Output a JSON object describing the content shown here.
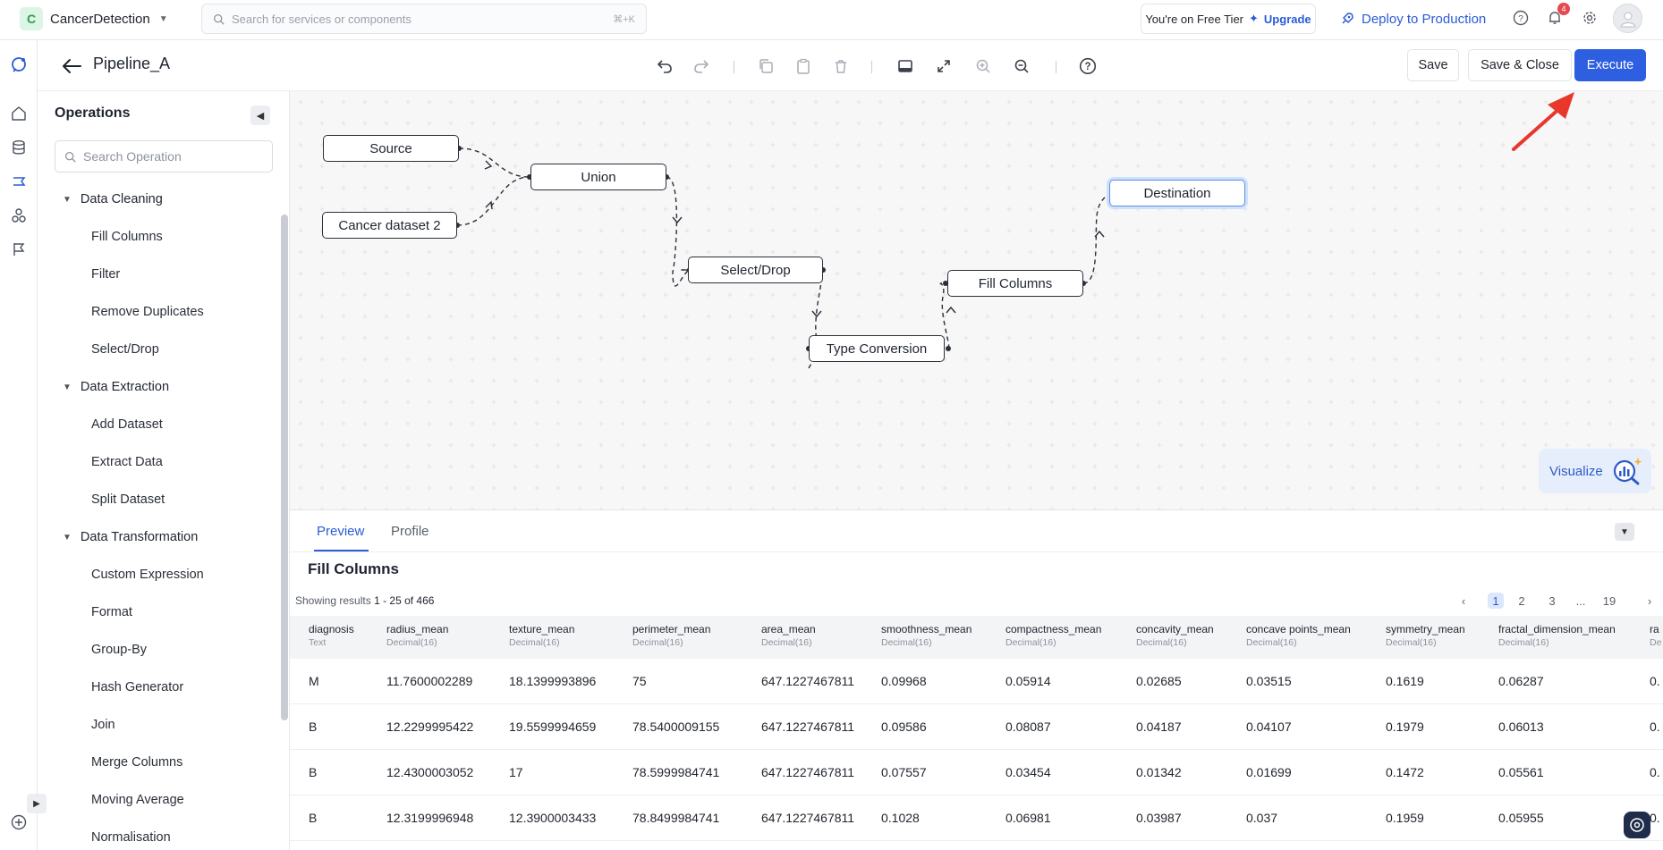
{
  "topbar": {
    "project_initial": "C",
    "project_name": "CancerDetection",
    "search_placeholder": "Search for services or components",
    "search_shortcut": "⌘+K",
    "tier_text": "You're on Free Tier",
    "upgrade_label": "Upgrade",
    "deploy_label": "Deploy to Production",
    "notification_count": "4"
  },
  "toolbar": {
    "pipeline_name": "Pipeline_A",
    "save_label": "Save",
    "save_close_label": "Save & Close",
    "execute_label": "Execute"
  },
  "operations": {
    "title": "Operations",
    "search_placeholder": "Search Operation",
    "groups": [
      {
        "label": "Data Cleaning",
        "items": [
          "Fill Columns",
          "Filter",
          "Remove Duplicates",
          "Select/Drop"
        ]
      },
      {
        "label": "Data Extraction",
        "items": [
          "Add Dataset",
          "Extract Data",
          "Split Dataset"
        ]
      },
      {
        "label": "Data Transformation",
        "items": [
          "Custom Expression",
          "Format",
          "Group-By",
          "Hash Generator",
          "Join",
          "Merge Columns",
          "Moving Average",
          "Normalisation"
        ]
      }
    ]
  },
  "canvas": {
    "nodes": {
      "source": "Source",
      "cancer_dataset_2": "Cancer dataset 2",
      "union": "Union",
      "select_drop": "Select/Drop",
      "type_conversion": "Type Conversion",
      "fill_columns": "Fill Columns",
      "destination": "Destination"
    },
    "visualize_label": "Visualize"
  },
  "bottom": {
    "tabs": [
      "Preview",
      "Profile"
    ],
    "active_tab": "Preview",
    "result_title": "Fill Columns",
    "showing_prefix": "Showing results",
    "showing_range": "1 - 25 of 466",
    "pages": [
      "1",
      "2",
      "3",
      "...",
      "19"
    ],
    "current_page": "1",
    "columns": [
      {
        "name": "diagnosis",
        "type": "Text"
      },
      {
        "name": "radius_mean",
        "type": "Decimal(16)"
      },
      {
        "name": "texture_mean",
        "type": "Decimal(16)"
      },
      {
        "name": "perimeter_mean",
        "type": "Decimal(16)"
      },
      {
        "name": "area_mean",
        "type": "Decimal(16)"
      },
      {
        "name": "smoothness_mean",
        "type": "Decimal(16)"
      },
      {
        "name": "compactness_mean",
        "type": "Decimal(16)"
      },
      {
        "name": "concavity_mean",
        "type": "Decimal(16)"
      },
      {
        "name": "concave points_mean",
        "type": "Decimal(16)"
      },
      {
        "name": "symmetry_mean",
        "type": "Decimal(16)"
      },
      {
        "name": "fractal_dimension_mean",
        "type": "Decimal(16)"
      },
      {
        "name": "ra",
        "type": "De"
      }
    ],
    "rows": [
      [
        "M",
        "11.7600002289",
        "18.1399993896",
        "75",
        "647.1227467811",
        "0.09968",
        "0.05914",
        "0.02685",
        "0.03515",
        "0.1619",
        "0.06287",
        "0."
      ],
      [
        "B",
        "12.2299995422",
        "19.5599994659",
        "78.5400009155",
        "647.1227467811",
        "0.09586",
        "0.08087",
        "0.04187",
        "0.04107",
        "0.1979",
        "0.06013",
        "0."
      ],
      [
        "B",
        "12.4300003052",
        "17",
        "78.5999984741",
        "647.1227467811",
        "0.07557",
        "0.03454",
        "0.01342",
        "0.01699",
        "0.1472",
        "0.05561",
        "0."
      ],
      [
        "B",
        "12.3199996948",
        "12.3900003433",
        "78.8499984741",
        "647.1227467811",
        "0.1028",
        "0.06981",
        "0.03987",
        "0.037",
        "0.1959",
        "0.05955",
        "0."
      ]
    ]
  },
  "colors": {
    "accent": "#2e5fe0",
    "notification": "#e5484d",
    "annotation_arrow": "#e8382c"
  }
}
